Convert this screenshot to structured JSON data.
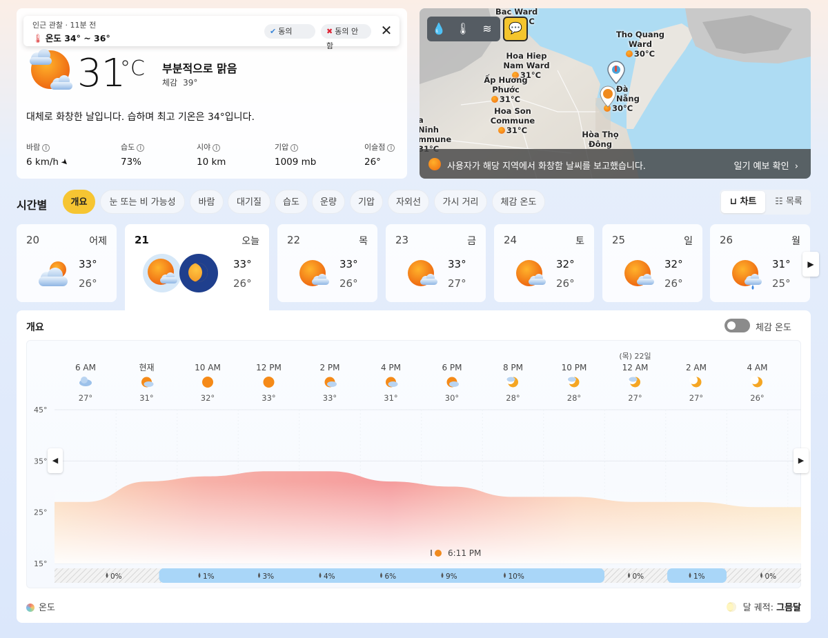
{
  "toast": {
    "subtitle": "인근 관찰 · 11분 전",
    "text": "온도 34° ~ 36°",
    "agree": "동의",
    "disagree": "동의 안 함"
  },
  "current": {
    "temp": "31",
    "unit": "°C",
    "condition": "부분적으로 맑음",
    "feels_label": "체감",
    "feels_value": "39°",
    "summary": "대체로 화창한 날입니다. 습하며 최고 기온은 34°입니다.",
    "stats": [
      {
        "label": "바람",
        "value": "6 km/h"
      },
      {
        "label": "습도",
        "value": "73%"
      },
      {
        "label": "시야",
        "value": "10 km"
      },
      {
        "label": "기압",
        "value": "1009 mb"
      },
      {
        "label": "이슬점",
        "value": "26°"
      }
    ]
  },
  "map": {
    "labels": [
      {
        "name": "Bac Ward",
        "temp": "C"
      },
      {
        "name": "Tho Quang Ward",
        "temp": "30°C"
      },
      {
        "name": "Hoa Hiep Nam Ward",
        "temp": "31°C"
      },
      {
        "name": "Ấp Hương Phước",
        "temp": "31°C"
      },
      {
        "name": "Đà Nẵng",
        "temp": "30°C"
      },
      {
        "name": "Hoa Son Commune",
        "temp": "31°C"
      },
      {
        "name": "a Ninh mmune",
        "temp": "31°C"
      },
      {
        "name": "Hòa Thọ Đông",
        "temp": ""
      }
    ],
    "banner_text": "사용자가 해당 지역에서 화창함 날씨를 보고했습니다.",
    "banner_link": "일기 예보 확인"
  },
  "hourly": {
    "title": "시간별",
    "tabs": [
      "개요",
      "눈 또는 비 가능성",
      "바람",
      "대기질",
      "습도",
      "운량",
      "기압",
      "자외선",
      "가시 거리",
      "체감 온도"
    ],
    "view_chart": "차트",
    "view_list": "목록"
  },
  "days": [
    {
      "num": "20",
      "name": "어제",
      "hi": "33°",
      "lo": "26°",
      "icon": "cloudy-sun-icon"
    },
    {
      "num": "21",
      "name": "오늘",
      "hi": "33°",
      "lo": "26°",
      "icon": "partly-sunny-icon"
    },
    {
      "num": "22",
      "name": "목",
      "hi": "33°",
      "lo": "26°",
      "icon": "partly-sunny-icon"
    },
    {
      "num": "23",
      "name": "금",
      "hi": "33°",
      "lo": "27°",
      "icon": "partly-sunny-icon"
    },
    {
      "num": "24",
      "name": "토",
      "hi": "32°",
      "lo": "26°",
      "icon": "partly-sunny-icon"
    },
    {
      "num": "25",
      "name": "일",
      "hi": "32°",
      "lo": "26°",
      "icon": "partly-sunny-icon"
    },
    {
      "num": "26",
      "name": "월",
      "hi": "31°",
      "lo": "25°",
      "icon": "rain-sun-icon"
    }
  ],
  "chart": {
    "title": "개요",
    "feels_toggle_label": "체감 온도",
    "legend_temp": "온도",
    "moon_label": "달 궤적:",
    "moon_value": "그믐달",
    "sunset_label": "6:11 PM"
  },
  "chart_data": {
    "type": "area",
    "x": [
      "6 AM",
      "현재",
      "10 AM",
      "12 PM",
      "2 PM",
      "4 PM",
      "6 PM",
      "8 PM",
      "10 PM",
      "12 AM",
      "2 AM",
      "4 AM"
    ],
    "date_marker": {
      "index": 9,
      "text": "(목) 22일"
    },
    "temps": [
      27,
      31,
      32,
      33,
      33,
      31,
      30,
      28,
      28,
      27,
      27,
      26
    ],
    "temp_labels": [
      "27°",
      "31°",
      "32°",
      "33°",
      "33°",
      "31°",
      "30°",
      "28°",
      "28°",
      "27°",
      "27°",
      "26°"
    ],
    "icons": [
      "cloudy-icon",
      "partly-sunny-icon",
      "sun-icon",
      "sun-icon",
      "partly-sunny-icon",
      "partly-sunny-icon",
      "partly-sunny-icon",
      "partly-moon-icon",
      "partly-moon-icon",
      "partly-moon-icon",
      "moon-icon",
      "moon-icon"
    ],
    "precip": [
      "0%",
      "1%",
      "3%",
      "4%",
      "6%",
      "9%",
      "10%",
      "0%",
      "1%",
      "0%"
    ],
    "y_ticks": [
      "45°",
      "35°",
      "25°",
      "15°"
    ],
    "ylim": [
      15,
      45
    ],
    "sunset_time": "6:11 PM"
  }
}
